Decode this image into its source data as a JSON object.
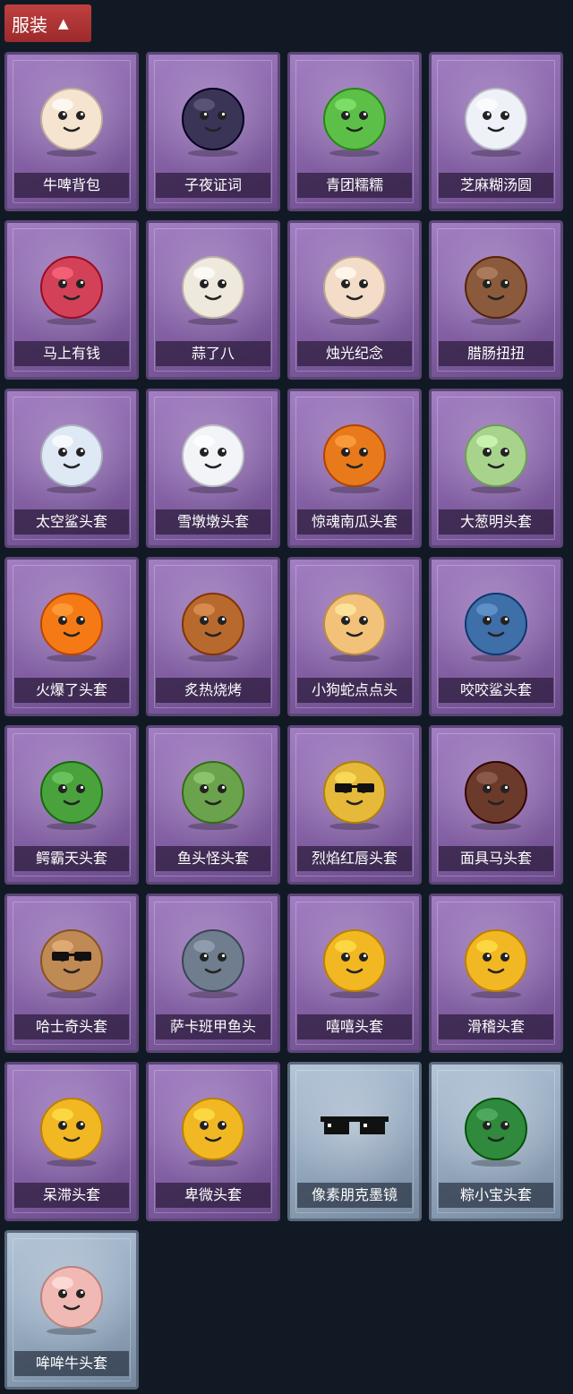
{
  "header": {
    "title": "服装",
    "toggle_icon": "chevron-up-icon"
  },
  "items": [
    {
      "label": "牛啤背包",
      "icon": "cow-beer-barrel-icon",
      "color": "#f4e4d0",
      "rarity": "purple"
    },
    {
      "label": "子夜证词",
      "icon": "crow-doctor-figure-icon",
      "color": "#3a3456",
      "rarity": "purple"
    },
    {
      "label": "青团糯糯",
      "icon": "green-rice-ball-icon",
      "color": "#5cc048",
      "rarity": "purple"
    },
    {
      "label": "芝麻糊汤圆",
      "icon": "dumpling-icon",
      "color": "#eef2f8",
      "rarity": "purple"
    },
    {
      "label": "马上有钱",
      "icon": "red-horse-head-icon",
      "color": "#d24158",
      "rarity": "purple"
    },
    {
      "label": "蒜了八",
      "icon": "garlic-icon",
      "color": "#efe9dd",
      "rarity": "purple"
    },
    {
      "label": "烛光纪念",
      "icon": "candle-icon",
      "color": "#f3dcc8",
      "rarity": "purple"
    },
    {
      "label": "腊肠扭扭",
      "icon": "sausage-dog-icon",
      "color": "#8b5a3c",
      "rarity": "purple"
    },
    {
      "label": "太空鲨头套",
      "icon": "space-shark-helmet-icon",
      "color": "#dfe8f5",
      "rarity": "purple"
    },
    {
      "label": "雪墩墩头套",
      "icon": "snowman-helmet-icon",
      "color": "#f2f4f8",
      "rarity": "purple"
    },
    {
      "label": "惊魂南瓜头套",
      "icon": "pumpkin-helmet-icon",
      "color": "#e87a1c",
      "rarity": "purple"
    },
    {
      "label": "大葱明头套",
      "icon": "scallion-helmet-icon",
      "color": "#a7d38d",
      "rarity": "purple"
    },
    {
      "label": "火爆了头套",
      "icon": "fire-helmet-icon",
      "color": "#f57a16",
      "rarity": "purple"
    },
    {
      "label": "炙热烧烤",
      "icon": "grilled-meat-icon",
      "color": "#b86a2e",
      "rarity": "purple"
    },
    {
      "label": "小狗蛇点点头",
      "icon": "dog-snake-icon",
      "color": "#f2c27a",
      "rarity": "purple"
    },
    {
      "label": "咬咬鲨头套",
      "icon": "shark-helmet-icon",
      "color": "#3f6fa8",
      "rarity": "purple"
    },
    {
      "label": "鳄霸天头套",
      "icon": "crocodile-helmet-icon",
      "color": "#49a23c",
      "rarity": "purple"
    },
    {
      "label": "鱼头怪头套",
      "icon": "fish-head-helmet-icon",
      "color": "#6aa34c",
      "rarity": "purple"
    },
    {
      "label": "烈焰红唇头套",
      "icon": "yellow-mask-sunglasses-icon",
      "color": "#e6b93a",
      "rarity": "purple"
    },
    {
      "label": "面具马头套",
      "icon": "horse-mask-icon",
      "color": "#6b3a2a",
      "rarity": "purple"
    },
    {
      "label": "哈士奇头套",
      "icon": "husky-sunglasses-icon",
      "color": "#c08a55",
      "rarity": "purple"
    },
    {
      "label": "萨卡班甲鱼头",
      "icon": "sacabambaspis-icon",
      "color": "#6f7d8e",
      "rarity": "purple"
    },
    {
      "label": "嘻嘻头套",
      "icon": "grin-emoji-icon",
      "color": "#f2b823",
      "rarity": "purple"
    },
    {
      "label": "滑稽头套",
      "icon": "smirk-emoji-icon",
      "color": "#f2b823",
      "rarity": "purple"
    },
    {
      "label": "呆滞头套",
      "icon": "dazed-emoji-icon",
      "color": "#f2b823",
      "rarity": "purple"
    },
    {
      "label": "卑微头套",
      "icon": "humble-emoji-icon",
      "color": "#f2b823",
      "rarity": "purple"
    },
    {
      "label": "像素朋克墨镜",
      "icon": "pixel-sunglasses-icon",
      "color": "#111111",
      "rarity": "blue"
    },
    {
      "label": "粽小宝头套",
      "icon": "zongzi-helmet-icon",
      "color": "#2f8a3e",
      "rarity": "blue"
    },
    {
      "label": "哞哞牛头套",
      "icon": "cow-helmet-icon",
      "color": "#f1b9b4",
      "rarity": "blue"
    }
  ]
}
